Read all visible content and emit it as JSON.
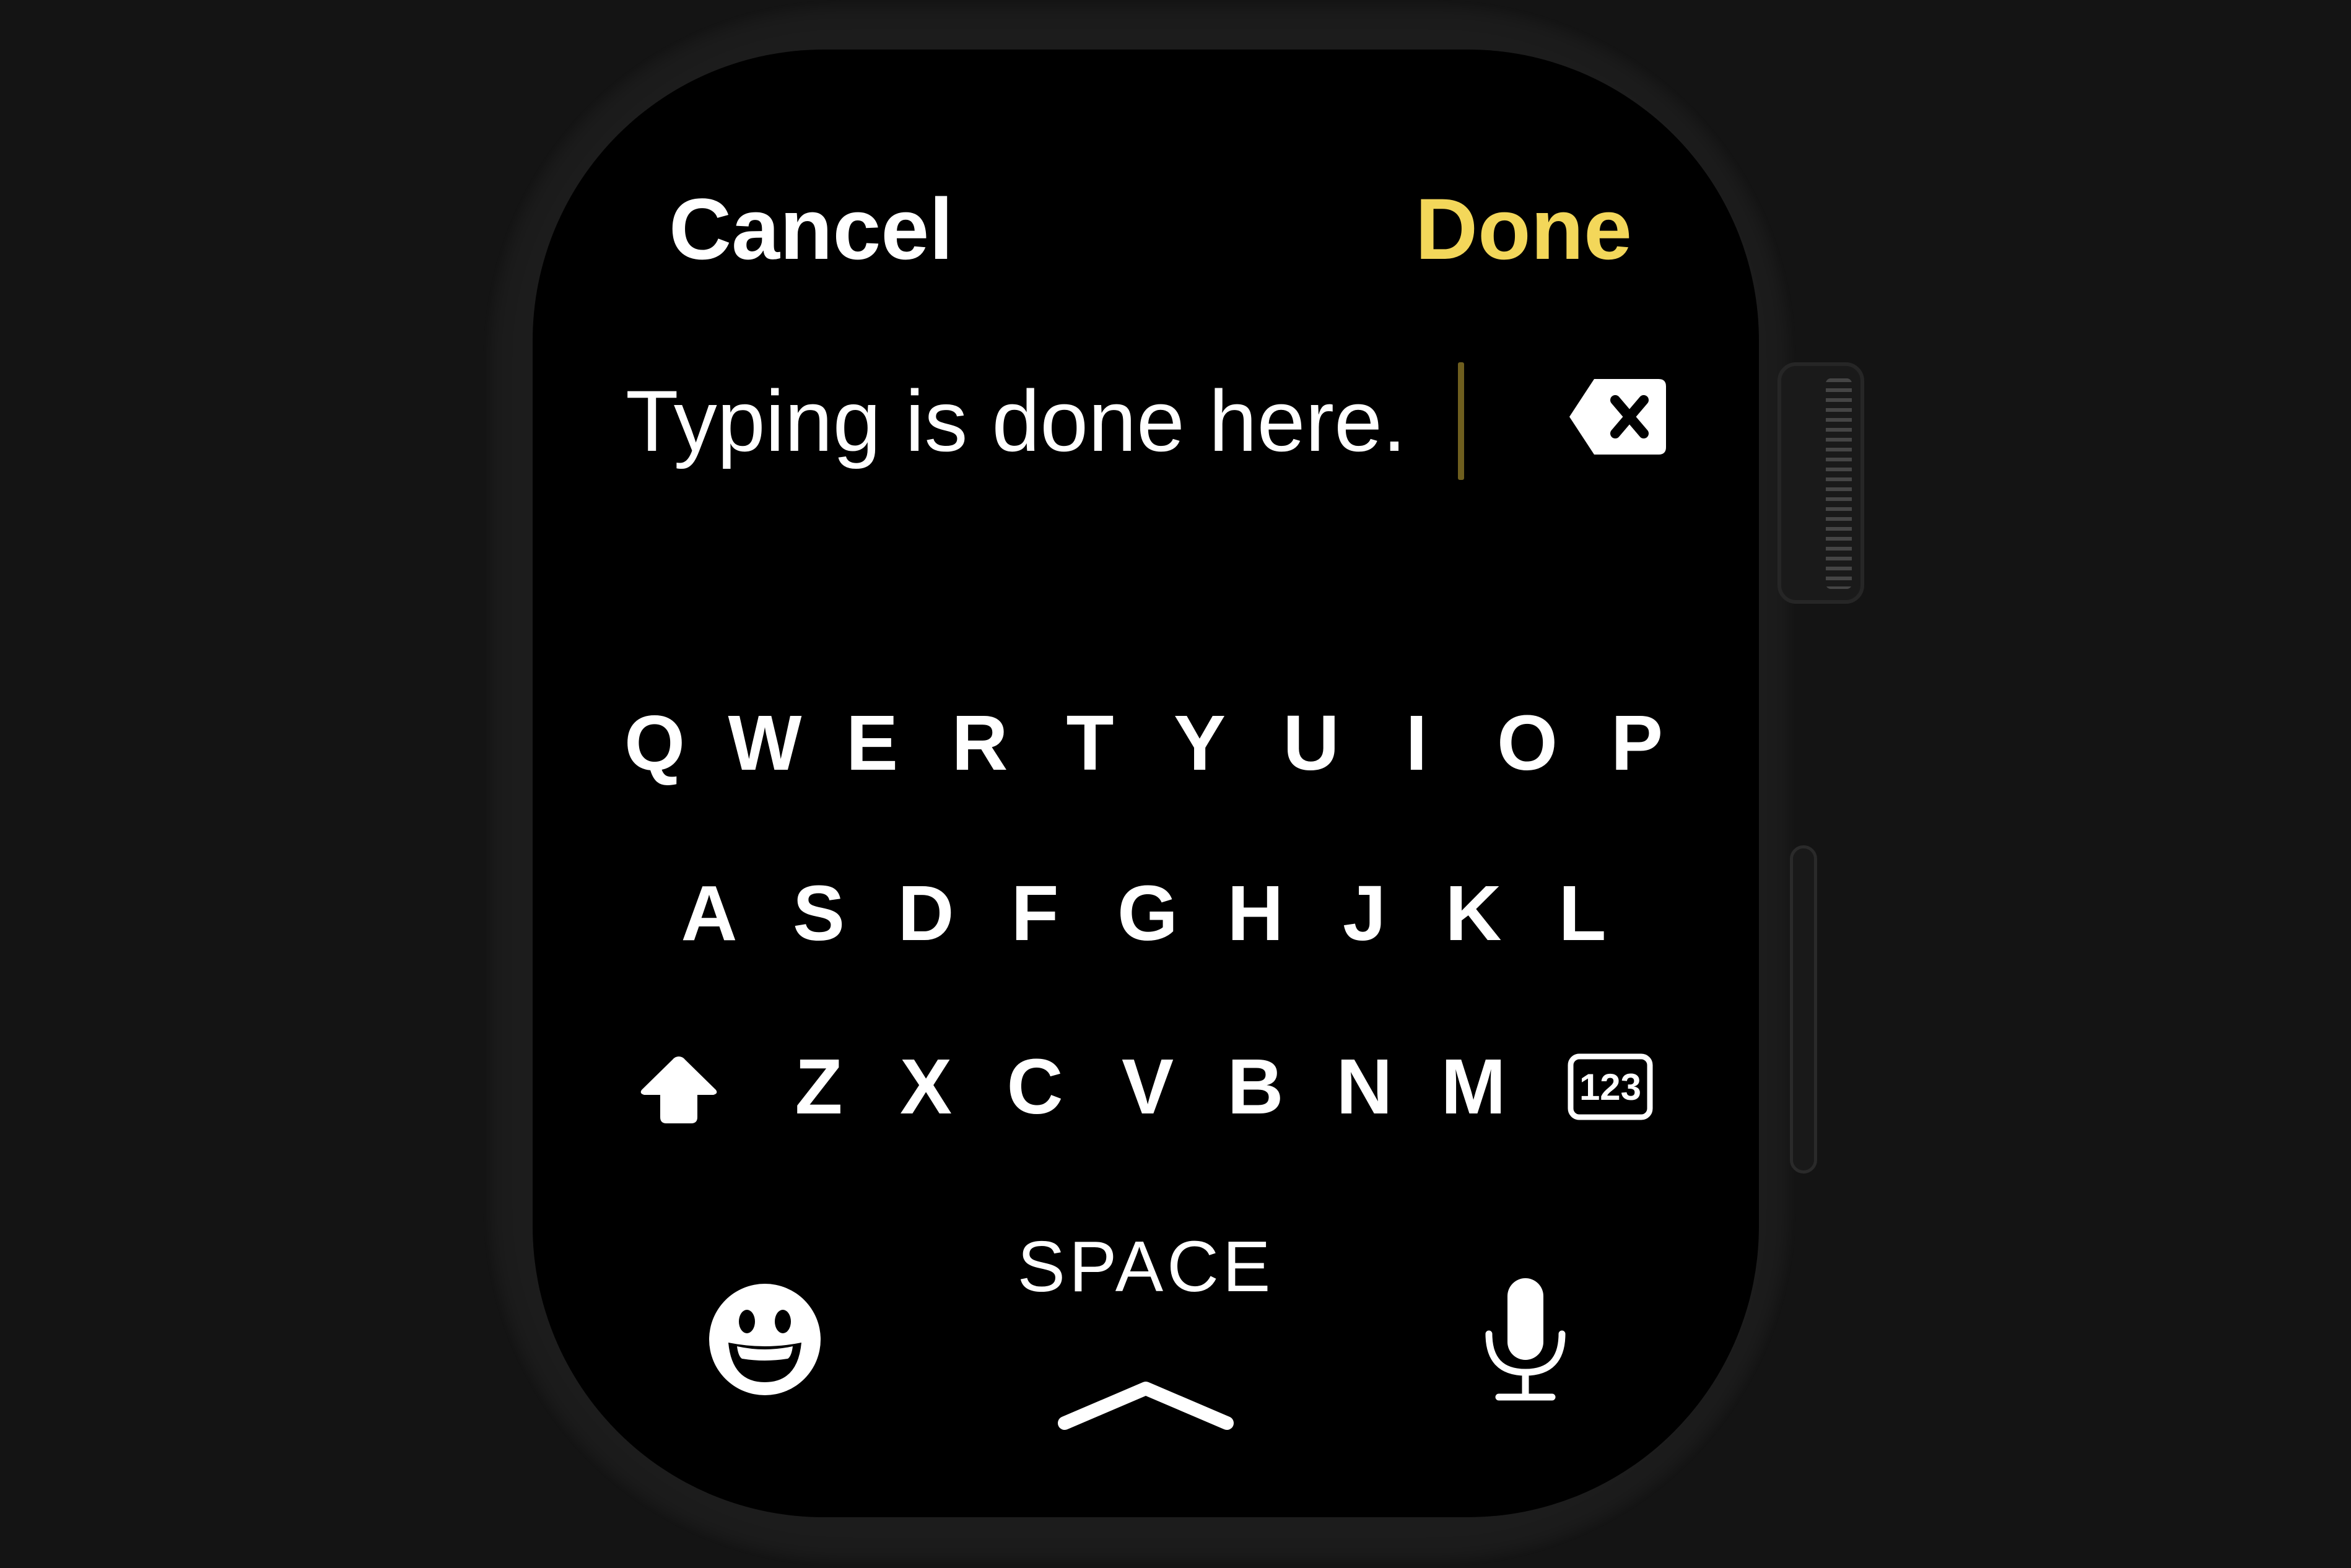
{
  "header": {
    "cancel_label": "Cancel",
    "done_label": "Done",
    "done_color": "#f3d75a"
  },
  "text_input": {
    "value": "Typing is done here.",
    "cursor_color": "#6e5e1e",
    "delete_icon": "delete-backward-icon"
  },
  "keyboard": {
    "row1": [
      "Q",
      "W",
      "E",
      "R",
      "T",
      "Y",
      "U",
      "I",
      "O",
      "P"
    ],
    "row2": [
      "A",
      "S",
      "D",
      "F",
      "G",
      "H",
      "J",
      "K",
      "L"
    ],
    "row3": [
      "Z",
      "X",
      "C",
      "V",
      "B",
      "N",
      "M"
    ],
    "shift_icon": "shift-icon",
    "numbers_label": "123",
    "space_label": "SPACE",
    "space_icon": "chevron-up-icon",
    "emoji_icon": "emoji-icon",
    "mic_icon": "microphone-icon"
  }
}
